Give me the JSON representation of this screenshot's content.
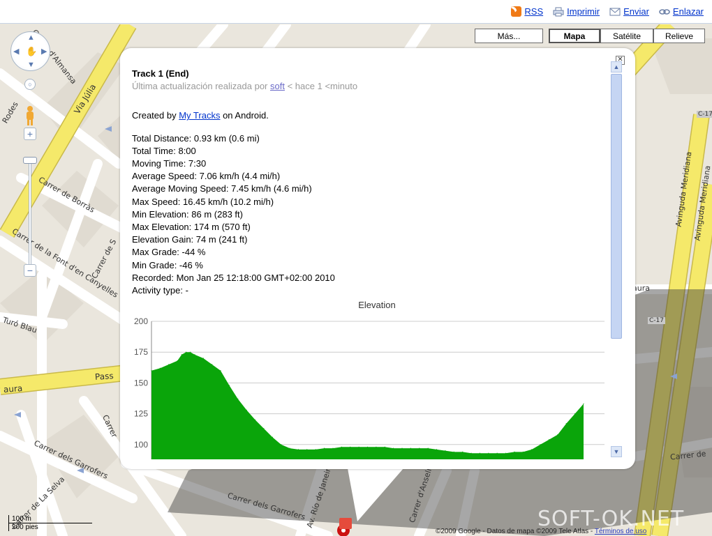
{
  "toolbar": {
    "rss_label": "RSS",
    "print_label": "Imprimir",
    "send_label": "Enviar",
    "link_label": "Enlazar"
  },
  "map_types": {
    "more_label": "Más...",
    "map_label": "Mapa",
    "satellite_label": "Satélite",
    "terrain_label": "Relieve",
    "active": "Mapa"
  },
  "streets": {
    "via_julia": "Via Júlia",
    "almansa": "Carrer d'Almansa",
    "borras": "Carrer de Borràs",
    "font_canyelles": "Carrer de la Font d'en Canyelles",
    "turo_blau": "Turó Blau",
    "garrofers_1": "Carrer dels Garrofers",
    "garrofers_2": "Carrer dels Garrofers",
    "la_selva": "Carrer de La Selva",
    "rio_janeiro": "Av. Río de Janeiro",
    "anselm": "Carrer d'Anselm T.",
    "meridiana_1": "Avinguda Meridiana",
    "meridiana_2": "Avinguda Meridiana",
    "c17_a": "C-17",
    "c17_b": "C-17",
    "passeig": "Pass",
    "aura": "aura",
    "carrer_de": "Carrer de",
    "rodes": "Rodes",
    "carrer_s": "Carrer de S",
    "carrer_f": "Carrer",
    "aura_right": "aura"
  },
  "info": {
    "title": "Track 1 (End)",
    "updated_prefix": "Última actualización realizada por",
    "updated_user": "soft",
    "updated_suffix": "< hace 1 <minuto",
    "created_prefix": "Created by",
    "created_link": "My Tracks",
    "created_suffix": "on Android.",
    "stats": [
      "Total Distance: 0.93 km (0.6 mi)",
      "Total Time: 8:00",
      "Moving Time: 7:30",
      "Average Speed: 7.06 km/h (4.4 mi/h)",
      "Average Moving Speed: 7.45 km/h (4.6 mi/h)",
      "Max Speed: 16.45 km/h (10.2 mi/h)",
      "Min Elevation: 86 m (283 ft)",
      "Max Elevation: 174 m (570 ft)",
      "Elevation Gain: 74 m (241 ft)",
      "Max Grade: -44 %",
      "Min Grade: -46 %",
      "Recorded: Mon Jan 25 12:18:00 GMT+02:00 2010",
      "Activity type: -"
    ],
    "close_label": "✕"
  },
  "chart_data": {
    "type": "area",
    "title": "Elevation",
    "xlabel": "",
    "ylabel": "",
    "ylim": [
      88,
      200
    ],
    "yticks": [
      100,
      125,
      150,
      175,
      200
    ],
    "grid": true,
    "color": "#0aa50a",
    "x": [
      0,
      2,
      4,
      6,
      7,
      8,
      9,
      10,
      12,
      14,
      16,
      18,
      20,
      22,
      24,
      26,
      28,
      30,
      32,
      34,
      36,
      38,
      40,
      42,
      44,
      46,
      48,
      50,
      52,
      54,
      56,
      58,
      60,
      62,
      64,
      66,
      68,
      70,
      72,
      74,
      76,
      78,
      80,
      82,
      84,
      86,
      88,
      90,
      92,
      94,
      96,
      98,
      100
    ],
    "y": [
      160,
      162,
      165,
      168,
      173,
      175,
      175,
      173,
      170,
      165,
      160,
      148,
      137,
      128,
      120,
      113,
      106,
      100,
      97,
      96,
      96,
      96,
      97,
      97,
      98,
      98,
      98,
      98,
      98,
      98,
      97,
      97,
      97,
      97,
      97,
      96,
      95,
      94,
      94,
      93,
      93,
      93,
      93,
      93,
      94,
      94,
      96,
      100,
      104,
      108,
      117,
      125,
      133
    ]
  },
  "footer": {
    "copyright": "©2009 Google - Datos de mapa ©2009 Tele Atlas -",
    "terms": "Términos de uso",
    "scale_m": "100 m",
    "scale_ft": "200 pies",
    "watermark": "SOFT-OK.NET"
  },
  "colors": {
    "road_yellow": "#f5e96a",
    "road_white": "#ffffff",
    "map_bg": "#eae6dd",
    "block": "#e3ded4",
    "elevation_fill": "#0aa50a",
    "link": "#0033cc"
  }
}
